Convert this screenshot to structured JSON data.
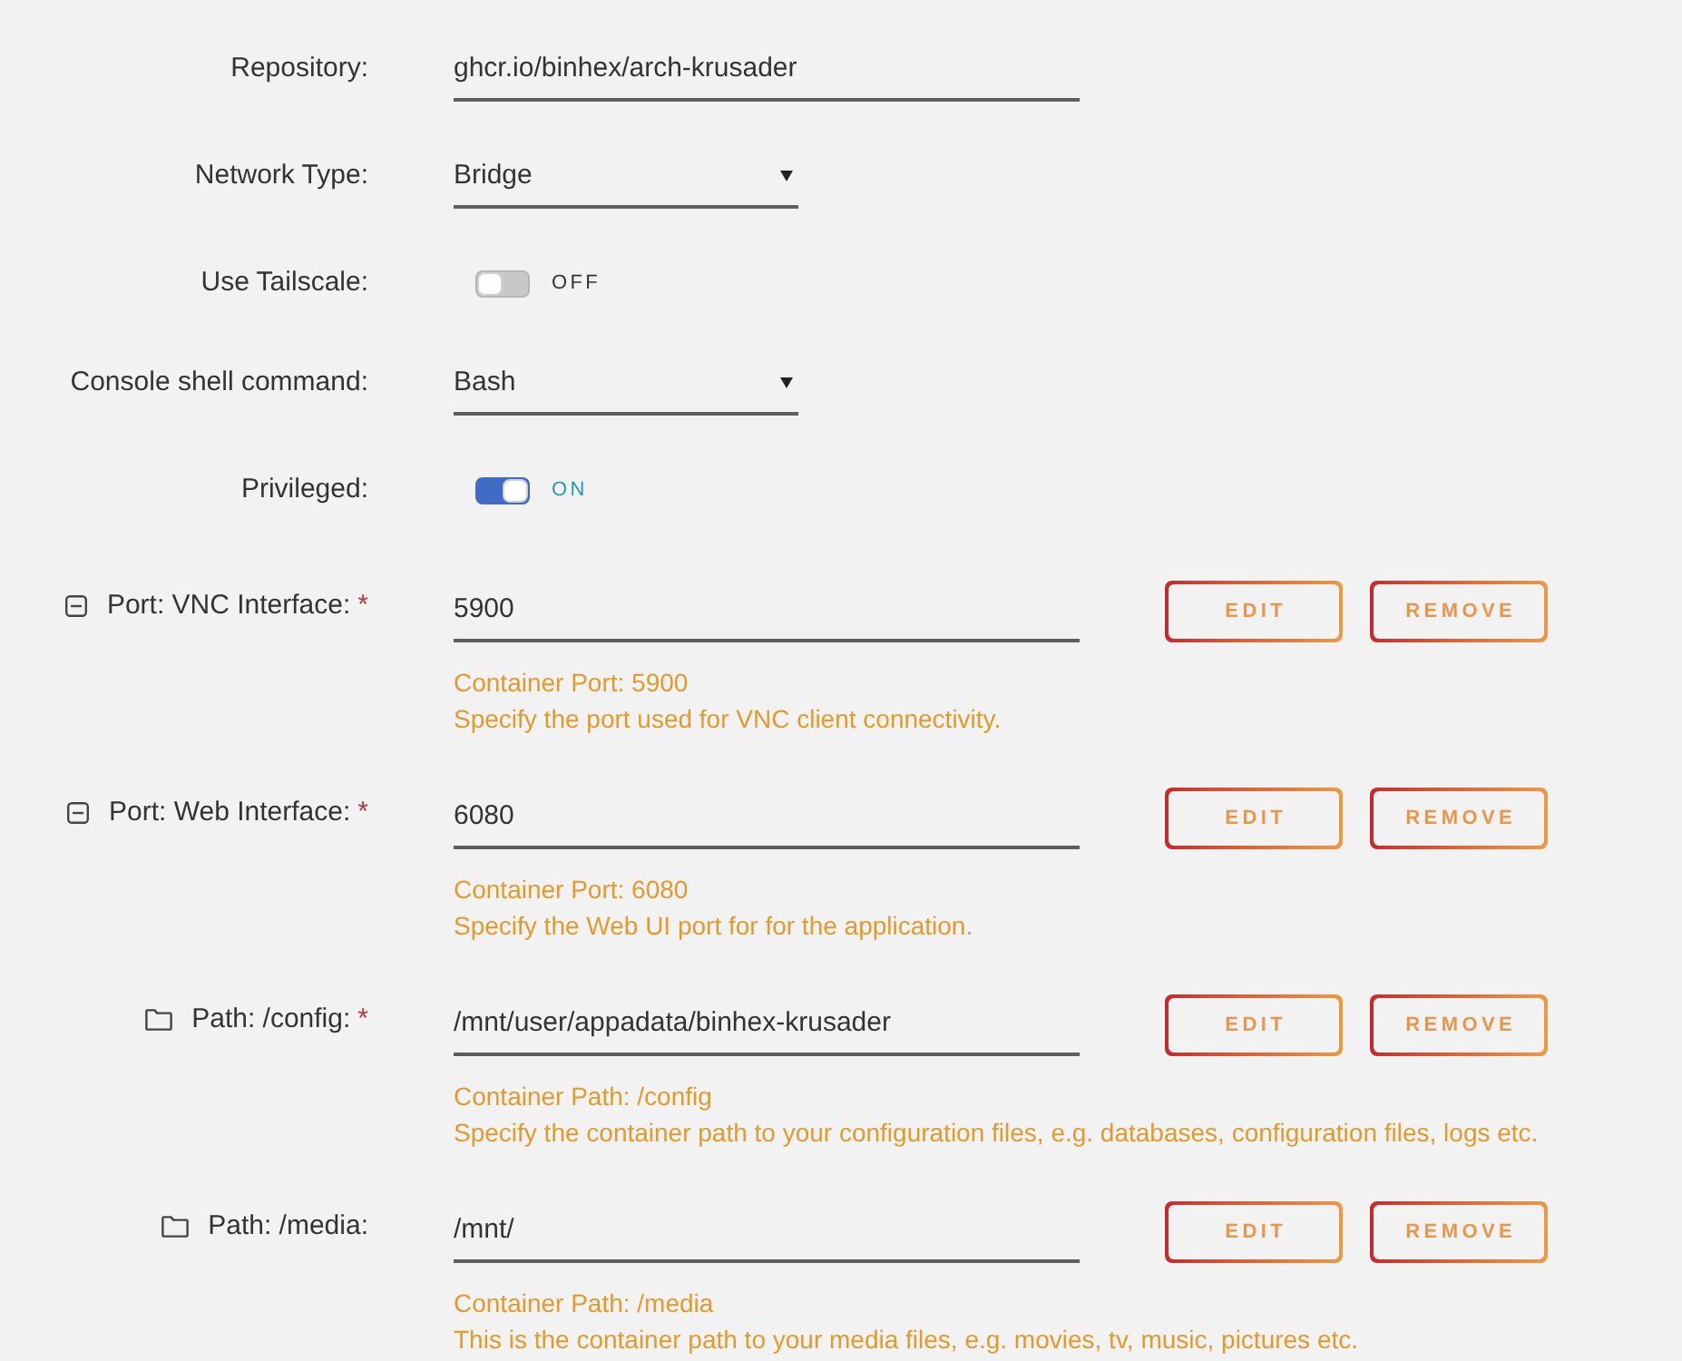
{
  "fields": [
    {
      "kind": "text",
      "label": "Repository:",
      "value": "ghcr.io/binhex/arch-krusader"
    },
    {
      "kind": "select",
      "label": "Network Type:",
      "value": "Bridge"
    },
    {
      "kind": "toggle",
      "label": "Use Tailscale:",
      "on": false,
      "state_text": "OFF"
    },
    {
      "kind": "select",
      "label": "Console shell command:",
      "value": "Bash"
    },
    {
      "kind": "toggle",
      "label": "Privileged:",
      "on": true,
      "state_text": "ON"
    }
  ],
  "mappings": [
    {
      "kind": "port",
      "label": "Port: VNC Interface:",
      "required_mark": "*",
      "value": "5900",
      "hints": [
        "Container Port: 5900",
        "Specify the port used for VNC client connectivity."
      ],
      "buttons": [
        "EDIT",
        "REMOVE"
      ]
    },
    {
      "kind": "port",
      "label": "Port: Web Interface:",
      "required_mark": "*",
      "value": "6080",
      "hints": [
        "Container Port: 6080",
        "Specify the Web UI port for for the application."
      ],
      "buttons": [
        "EDIT",
        "REMOVE"
      ]
    },
    {
      "kind": "path",
      "label": "Path: /config:",
      "required_mark": "*",
      "value": "/mnt/user/appadata/binhex-krusader",
      "hints": [
        "Container Path: /config",
        "Specify the container path to your configuration files, e.g. databases, configuration files, logs etc."
      ],
      "buttons": [
        "EDIT",
        "REMOVE"
      ]
    },
    {
      "kind": "path",
      "label": "Path: /media:",
      "value": "/mnt/",
      "hints": [
        "Container Path: /media",
        "This is the container path to your media files, e.g. movies, tv, music, pictures etc."
      ],
      "buttons": [
        "EDIT",
        "REMOVE"
      ]
    }
  ]
}
